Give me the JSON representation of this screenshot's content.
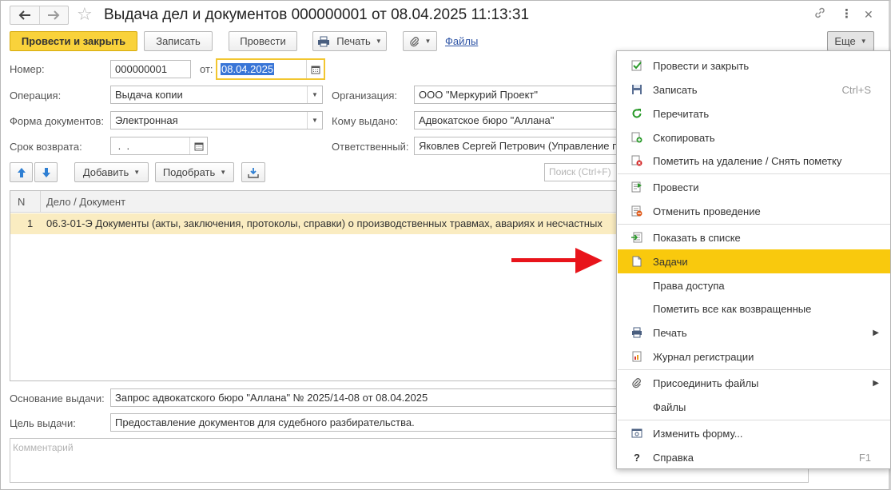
{
  "window": {
    "title": "Выдача дел и документов 000000001 от 08.04.2025 11:13:31"
  },
  "toolbar": {
    "post_close": "Провести и закрыть",
    "save": "Записать",
    "post": "Провести",
    "print": "Печать",
    "files_link": "Файлы",
    "more": "Еще"
  },
  "form": {
    "number_label": "Номер:",
    "number_value": "000000001",
    "date_label": "от:",
    "date_value": "08.04.2025",
    "operation_label": "Операция:",
    "operation_value": "Выдача копии",
    "organization_label": "Организация:",
    "organization_value": "ООО \"Меркурий Проект\"",
    "doc_form_label": "Форма документов:",
    "doc_form_value": "Электронная",
    "issued_to_label": "Кому выдано:",
    "issued_to_value": "Адвокатское бюро \"Аллана\"",
    "return_label": "Срок возврата:",
    "return_value": " .  .",
    "responsible_label": "Ответственный:",
    "responsible_value": "Яковлев Сергей Петрович (Управление п",
    "basis_label": "Основание выдачи:",
    "basis_value": "Запрос адвокатского бюро \"Аллана\" № 2025/14-08 от 08.04.2025",
    "purpose_label": "Цель выдачи:",
    "purpose_value": "Предоставление документов для судебного разбирательства.",
    "comment_placeholder": "Комментарий"
  },
  "table_toolbar": {
    "add": "Добавить",
    "pick": "Подобрать",
    "search_placeholder": "Поиск (Ctrl+F)"
  },
  "table": {
    "columns": [
      "N",
      "Дело / Документ"
    ],
    "rows": [
      {
        "n": "1",
        "doc": "06.3-01-Э Документы (акты, заключения, протоколы, справки) о производственных травмах, авариях и несчастных"
      }
    ]
  },
  "menu": {
    "items": [
      {
        "label": "Провести и закрыть",
        "icon": "post-close-icon"
      },
      {
        "label": "Записать",
        "shortcut": "Ctrl+S",
        "icon": "save-icon"
      },
      {
        "label": "Перечитать",
        "icon": "refresh-icon"
      },
      {
        "label": "Скопировать",
        "icon": "copy-icon"
      },
      {
        "label": "Пометить на удаление / Снять пометку",
        "icon": "delete-mark-icon"
      },
      {
        "label": "Провести",
        "icon": "post-icon"
      },
      {
        "label": "Отменить проведение",
        "icon": "unpost-icon"
      },
      {
        "label": "Показать в списке",
        "icon": "show-in-list-icon"
      },
      {
        "label": "Задачи",
        "icon": "tasks-icon",
        "highlighted": true
      },
      {
        "label": "Права доступа"
      },
      {
        "label": "Пометить все как возвращенные"
      },
      {
        "label": "Печать",
        "icon": "print-icon",
        "submenu": true
      },
      {
        "label": "Журнал регистрации",
        "icon": "log-icon"
      },
      {
        "label": "Присоединить файлы",
        "icon": "attach-icon",
        "submenu": true
      },
      {
        "label": "Файлы"
      },
      {
        "label": "Изменить форму...",
        "icon": "change-form-icon"
      },
      {
        "label": "Справка",
        "shortcut": "F1",
        "icon": "help-icon"
      }
    ]
  },
  "colors": {
    "primary_button": "#f9d23b",
    "highlight": "#f9c90d",
    "selected_row": "#faecc1",
    "link": "#2f55a6",
    "arrow": "#e8141b"
  }
}
